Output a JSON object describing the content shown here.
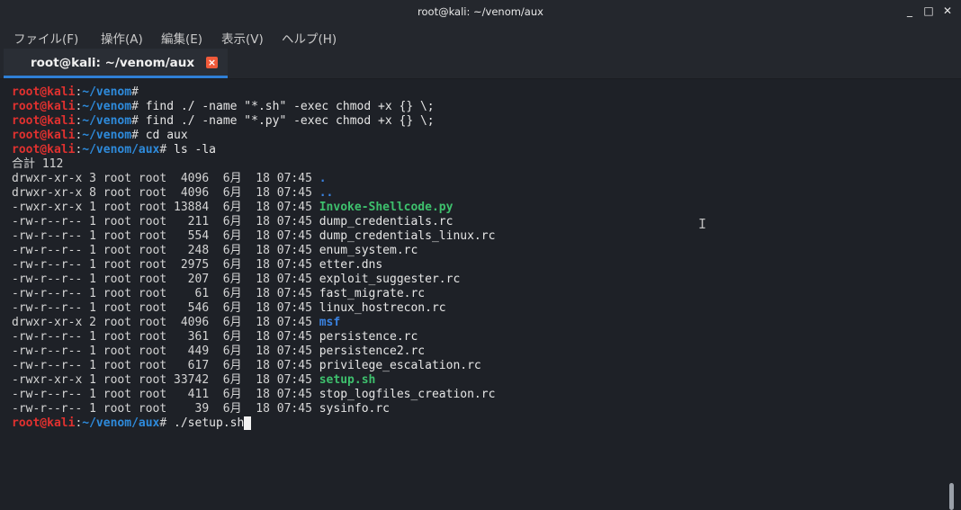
{
  "window": {
    "title": "root@kali: ~/venom/aux",
    "minimize_glyph": "_",
    "maximize_glyph": "□",
    "close_glyph": "✕"
  },
  "menu": [
    "ファイル(F)",
    "操作(A)",
    "編集(E)",
    "表示(V)",
    "ヘルプ(H)"
  ],
  "tab": {
    "label": "root@kali: ~/venom/aux",
    "close_glyph": "×",
    "accent": "#2f7fd6",
    "close_color": "#f05a3a"
  },
  "colors": {
    "background": "#1e2127",
    "prompt_user": "#e0312f",
    "prompt_path": "#2e8bdc",
    "directory": "#3a82e0",
    "executable": "#3ec06d"
  },
  "prompt": {
    "user": "root@kali",
    "sep": ":"
  },
  "terminal": {
    "lines": [
      {
        "type": "prompt",
        "path": "~/venom",
        "cmd": ""
      },
      {
        "type": "prompt",
        "path": "~/venom",
        "cmd": " find ./ -name \"*.sh\" -exec chmod +x {} \\;"
      },
      {
        "type": "prompt",
        "path": "~/venom",
        "cmd": " find ./ -name \"*.py\" -exec chmod +x {} \\;"
      },
      {
        "type": "prompt",
        "path": "~/venom",
        "cmd": " cd aux"
      },
      {
        "type": "prompt",
        "path": "~/venom/aux",
        "cmd": " ls -la"
      },
      {
        "type": "text",
        "text": "合計 112"
      },
      {
        "type": "entry",
        "meta": "drwxr-xr-x 3 root root  4096  6月  18 07:45 ",
        "name": ".",
        "kind": "dir"
      },
      {
        "type": "entry",
        "meta": "drwxr-xr-x 8 root root  4096  6月  18 07:45 ",
        "name": "..",
        "kind": "dir"
      },
      {
        "type": "entry",
        "meta": "-rwxr-xr-x 1 root root 13884  6月  18 07:45 ",
        "name": "Invoke-Shellcode.py",
        "kind": "exe"
      },
      {
        "type": "entry",
        "meta": "-rw-r--r-- 1 root root   211  6月  18 07:45 ",
        "name": "dump_credentials.rc",
        "kind": "file"
      },
      {
        "type": "entry",
        "meta": "-rw-r--r-- 1 root root   554  6月  18 07:45 ",
        "name": "dump_credentials_linux.rc",
        "kind": "file"
      },
      {
        "type": "entry",
        "meta": "-rw-r--r-- 1 root root   248  6月  18 07:45 ",
        "name": "enum_system.rc",
        "kind": "file"
      },
      {
        "type": "entry",
        "meta": "-rw-r--r-- 1 root root  2975  6月  18 07:45 ",
        "name": "etter.dns",
        "kind": "file"
      },
      {
        "type": "entry",
        "meta": "-rw-r--r-- 1 root root   207  6月  18 07:45 ",
        "name": "exploit_suggester.rc",
        "kind": "file"
      },
      {
        "type": "entry",
        "meta": "-rw-r--r-- 1 root root    61  6月  18 07:45 ",
        "name": "fast_migrate.rc",
        "kind": "file"
      },
      {
        "type": "entry",
        "meta": "-rw-r--r-- 1 root root   546  6月  18 07:45 ",
        "name": "linux_hostrecon.rc",
        "kind": "file"
      },
      {
        "type": "entry",
        "meta": "drwxr-xr-x 2 root root  4096  6月  18 07:45 ",
        "name": "msf",
        "kind": "dir"
      },
      {
        "type": "entry",
        "meta": "-rw-r--r-- 1 root root   361  6月  18 07:45 ",
        "name": "persistence.rc",
        "kind": "file"
      },
      {
        "type": "entry",
        "meta": "-rw-r--r-- 1 root root   449  6月  18 07:45 ",
        "name": "persistence2.rc",
        "kind": "file"
      },
      {
        "type": "entry",
        "meta": "-rw-r--r-- 1 root root   617  6月  18 07:45 ",
        "name": "privilege_escalation.rc",
        "kind": "file"
      },
      {
        "type": "entry",
        "meta": "-rwxr-xr-x 1 root root 33742  6月  18 07:45 ",
        "name": "setup.sh",
        "kind": "exe"
      },
      {
        "type": "entry",
        "meta": "-rw-r--r-- 1 root root   411  6月  18 07:45 ",
        "name": "stop_logfiles_creation.rc",
        "kind": "file"
      },
      {
        "type": "entry",
        "meta": "-rw-r--r-- 1 root root    39  6月  18 07:45 ",
        "name": "sysinfo.rc",
        "kind": "file"
      },
      {
        "type": "prompt",
        "path": "~/venom/aux",
        "cmd": " ./setup.sh",
        "cursor": true
      }
    ]
  }
}
